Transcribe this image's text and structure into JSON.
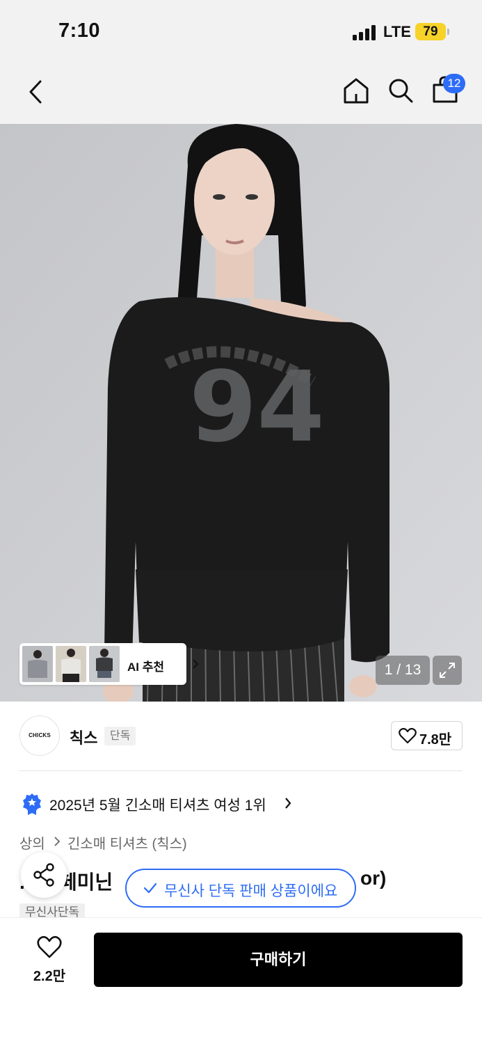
{
  "status_bar": {
    "time": "7:10",
    "network": "LTE",
    "battery": "79"
  },
  "nav": {
    "cart_count": "12"
  },
  "gallery": {
    "ai_label": "AI 추천",
    "counter": "1 / 13"
  },
  "brand": {
    "logo_text": "CHICKS",
    "name": "칙스",
    "tag": "단독",
    "likes": "7.8만"
  },
  "ranking": {
    "text": "2025년 5월 긴소매 티셔츠 여성 1위"
  },
  "breadcrumb": {
    "category": "상의",
    "subcategory": "긴소매 티셔츠 (칙스)"
  },
  "product": {
    "title_left": "...힐 페미닌",
    "title_right": "or)",
    "badge": "무신사단독"
  },
  "toast": {
    "text": "무신사 단독 판매 상품이에요"
  },
  "bottom_bar": {
    "wish_count": "2.2만",
    "buy_label": "구매하기"
  },
  "colors": {
    "accent": "#2d6cf6",
    "buy_button": "#000000",
    "battery": "#f7d229"
  }
}
